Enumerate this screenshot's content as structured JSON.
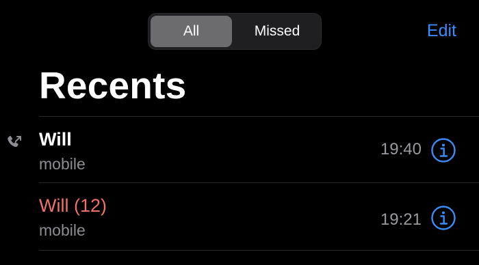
{
  "segmented": {
    "options": [
      "All",
      "Missed"
    ],
    "selected": "All"
  },
  "header": {
    "edit_label": "Edit",
    "title": "Recents"
  },
  "calls": [
    {
      "name": "Will",
      "type_label": "mobile",
      "time": "19:40",
      "missed": false,
      "direction_icon": "outgoing-call-icon"
    },
    {
      "name": "Will (12)",
      "type_label": "mobile",
      "time": "19:21",
      "missed": true
    }
  ],
  "colors": {
    "accent": "#3c8bfa",
    "missed": "#f0706c",
    "secondary_text": "#8d8d93",
    "background": "#000000"
  }
}
